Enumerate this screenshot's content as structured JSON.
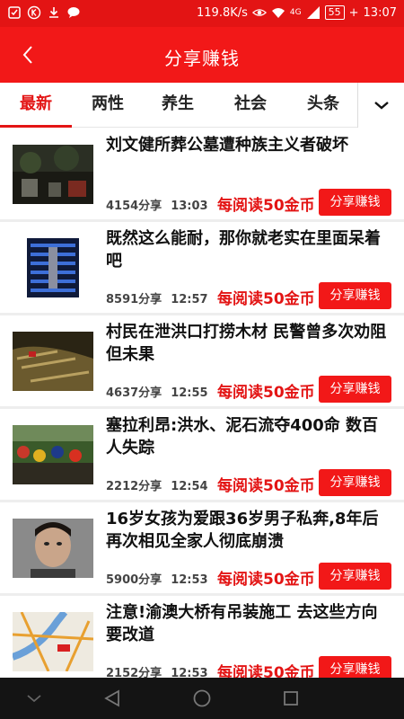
{
  "status_bar": {
    "network_speed": "119.8K/s",
    "network_type": "4G",
    "battery_level": "55",
    "time": "13:07",
    "left_icons": [
      "notification-icon",
      "k-app-icon",
      "download-icon",
      "message-icon"
    ],
    "right_icons": [
      "eye-icon",
      "wifi-icon",
      "signal-icon",
      "battery-icon"
    ]
  },
  "header": {
    "title": "分享赚钱",
    "back_icon": "chevron-left-icon",
    "color": "#f21818"
  },
  "tabs": {
    "items": [
      {
        "label": "最新",
        "active": true
      },
      {
        "label": "两性",
        "active": false
      },
      {
        "label": "养生",
        "active": false
      },
      {
        "label": "社会",
        "active": false
      },
      {
        "label": "头条",
        "active": false
      }
    ],
    "more_icon": "chevron-down-icon",
    "accent": "#e31414"
  },
  "articles": [
    {
      "title": "刘文健所葬公墓遭种族主义者破坏",
      "shares": "4154分享",
      "time": "13:03",
      "reward": "每阅读50金币",
      "button": "分享赚钱"
    },
    {
      "title": "既然这么能耐，那你就老实在里面呆着吧",
      "shares": "8591分享",
      "time": "12:57",
      "reward": "每阅读50金币",
      "button": "分享赚钱"
    },
    {
      "title": "村民在泄洪口打捞木材 民警曾多次劝阻但未果",
      "shares": "4637分享",
      "time": "12:55",
      "reward": "每阅读50金币",
      "button": "分享赚钱"
    },
    {
      "title": "塞拉利昂:洪水、泥石流夺400命 数百人失踪",
      "shares": "2212分享",
      "time": "12:54",
      "reward": "每阅读50金币",
      "button": "分享赚钱"
    },
    {
      "title": "16岁女孩为爱跟36岁男子私奔,8年后再次相见全家人彻底崩溃",
      "shares": "5900分享",
      "time": "12:53",
      "reward": "每阅读50金币",
      "button": "分享赚钱"
    },
    {
      "title": "注意!渝澳大桥有吊装施工 去这些方向要改道",
      "shares": "2152分享",
      "time": "12:53",
      "reward": "每阅读50金币",
      "button": "分享赚钱"
    }
  ],
  "nav_bar": {
    "icons": [
      "collapse-icon",
      "back-triangle-icon",
      "home-circle-icon",
      "recents-square-icon"
    ]
  }
}
